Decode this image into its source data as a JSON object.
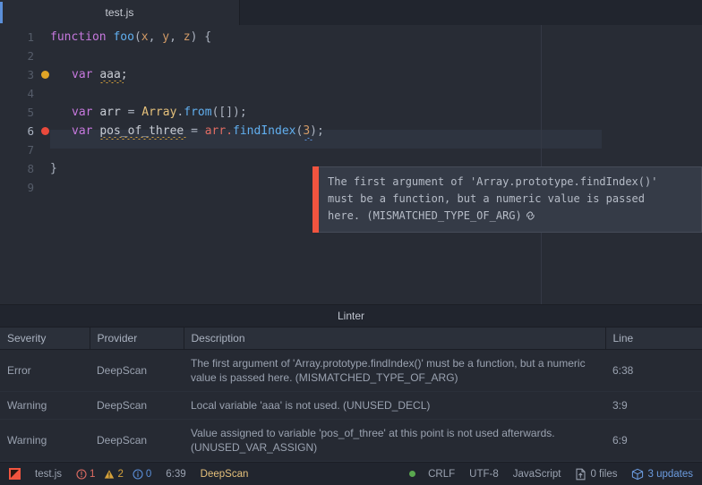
{
  "tab": {
    "label": "test.js",
    "accent_color": "#5b8fd9"
  },
  "editor": {
    "line_numbers": [
      "1",
      "2",
      "3",
      "4",
      "5",
      "6",
      "7",
      "8",
      "9"
    ],
    "current_line": 6,
    "markers": [
      {
        "line": 3,
        "type": "warning",
        "color": "#e0a526"
      },
      {
        "line": 6,
        "type": "error",
        "color": "#ea4a3c"
      }
    ],
    "lines": [
      {
        "n": 1,
        "text": "function foo(x, y, z) {"
      },
      {
        "n": 2,
        "text": ""
      },
      {
        "n": 3,
        "text": "    var aaa;"
      },
      {
        "n": 4,
        "text": ""
      },
      {
        "n": 5,
        "text": "    var arr = Array.from([]);"
      },
      {
        "n": 6,
        "text": "    var pos_of_three = arr.findIndex(3);"
      },
      {
        "n": 7,
        "text": ""
      },
      {
        "n": 8,
        "text": "}"
      },
      {
        "n": 9,
        "text": ""
      }
    ],
    "tokens": {
      "kw_function": "function",
      "fn_foo": "foo",
      "paren_open": "(",
      "p_x": "x",
      "comma1": ", ",
      "p_y": "y",
      "comma2": ", ",
      "p_z": "z",
      "close_brace": ") {",
      "kw_var": "var",
      "id_aaa": "aaa;",
      "id_arr": "arr",
      "eq": "=",
      "cls_array": "Array",
      "dot": ".",
      "fn_from": "from",
      "from_args": "([]);",
      "id_pos": "pos_of_three",
      "id_arr2": "arr",
      "fn_findindex": "findIndex",
      "num_3": "3",
      "semi": ");",
      "brace_close": "}"
    }
  },
  "tooltip": {
    "line1": "The first argument of 'Array.prototype.findIndex()'",
    "line2": "must be a function, but a numeric value is passed",
    "line3": "here. (MISMATCHED_TYPE_OF_ARG)",
    "accent_color": "#f1543f",
    "link_icon": "chain-link-icon"
  },
  "panel": {
    "title": "Linter",
    "columns": [
      "Severity",
      "Provider",
      "Description",
      "Line"
    ],
    "rows": [
      {
        "severity": "Error",
        "provider": "DeepScan",
        "description": "The first argument of 'Array.prototype.findIndex()' must be a function, but a numeric value is passed here. (MISMATCHED_TYPE_OF_ARG)",
        "line": "6:38"
      },
      {
        "severity": "Warning",
        "provider": "DeepScan",
        "description": "Local variable 'aaa' is not used. (UNUSED_DECL)",
        "line": "3:9"
      },
      {
        "severity": "Warning",
        "provider": "DeepScan",
        "description": "Value assigned to variable 'pos_of_three' at this point is not used afterwards. (UNUSED_VAR_ASSIGN)",
        "line": "6:9"
      }
    ]
  },
  "statusbar": {
    "logo": "deepscan-logo-icon",
    "filename": "test.js",
    "error_icon": "error-circle-icon",
    "error_count": "1",
    "warning_icon": "warning-triangle-icon",
    "warning_count": "2",
    "info_icon": "info-circle-icon",
    "info_count": "0",
    "cursor_position": "6:39",
    "provider": "DeepScan",
    "status_dot_color": "#5aa84f",
    "line_ending": "CRLF",
    "encoding": "UTF-8",
    "language": "JavaScript",
    "files_icon": "file-upload-icon",
    "files_label": "0 files",
    "updates_icon": "package-box-icon",
    "updates_label": "3 updates"
  }
}
